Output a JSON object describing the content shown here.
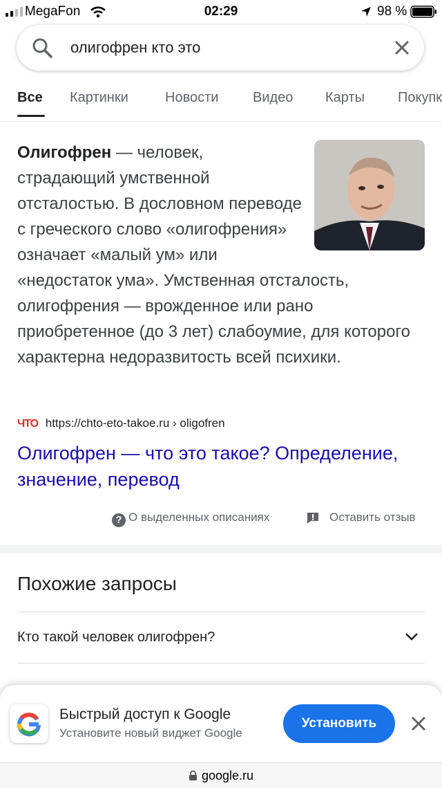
{
  "status": {
    "carrier": "MegaFon",
    "time": "02:29",
    "battery": "98 %"
  },
  "search": {
    "query": "олигофрен кто это"
  },
  "tabs": [
    {
      "label": "Все"
    },
    {
      "label": "Картинки"
    },
    {
      "label": "Новости"
    },
    {
      "label": "Видео"
    },
    {
      "label": "Карты"
    },
    {
      "label": "Покупки"
    }
  ],
  "snippet": {
    "term": "Олигофрен",
    "text": " — человек, страдающий умственной отсталостью. В дословном переводе с греческого слово «олигофрения» означает «малый ум» или «недостаток ума». Умственная отсталость, олигофрения — врожденное или рано приобретенное (до 3 лет) слабоумие, для которого характерна недоразвитость всей психики."
  },
  "source": {
    "favicon_text": "ЧТО",
    "url": "https://chto-eto-takoe.ru › oligofren",
    "title": "Олигофрен — что это такое? Определение, значение, перевод"
  },
  "feedback": {
    "about": "О выделенных описаниях",
    "leave": "Оставить отзыв"
  },
  "related": {
    "title": "Похожие запросы",
    "items": [
      "Кто такой человек олигофрен?"
    ]
  },
  "sheet": {
    "title": "Быстрый доступ к Google",
    "subtitle": "Установите новый виджет Google",
    "button": "Установить"
  },
  "url_bar": {
    "domain": "google.ru"
  },
  "colors": {
    "link": "#1a0dab",
    "accent": "#1a73e8"
  }
}
